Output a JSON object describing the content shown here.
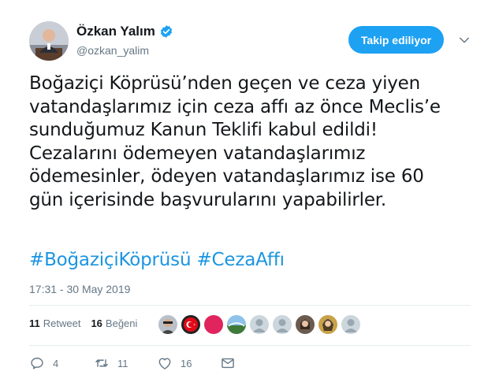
{
  "author": {
    "name": "Özkan Yalım",
    "handle": "@ozkan_yalim",
    "verified_icon": "verified-badge-icon"
  },
  "follow_button": {
    "label": "Takip ediliyor"
  },
  "tweet": {
    "lines": [
      "Boğaziçi Köprüsü’nden geçen ve ceza yiyen",
      "vatandaşlarımız için ceza affı az önce Meclis’e",
      "sunduğumuz Kanun Teklifi kabul edildi!",
      "Cezalarını ödemeyen vatandaşlarımız",
      "ödemesinler, ödeyen vatandaşlarımız ise 60",
      "gün içerisinde başvurularını yapabilirler."
    ],
    "hashtags": [
      "#BoğaziçiKöprüsü",
      "#CezaAffı"
    ],
    "timestamp": "17:31 - 30 May 2019"
  },
  "stats": {
    "retweets": {
      "count": "11",
      "label": "Retweet"
    },
    "likes": {
      "count": "16",
      "label": "Beğeni"
    }
  },
  "actions": {
    "reply_count": "4",
    "retweet_count": "11",
    "like_count": "16"
  },
  "colors": {
    "accent": "#1da1f2",
    "link": "#1b95e0",
    "muted": "#657786",
    "divider": "#e6ecf0"
  }
}
